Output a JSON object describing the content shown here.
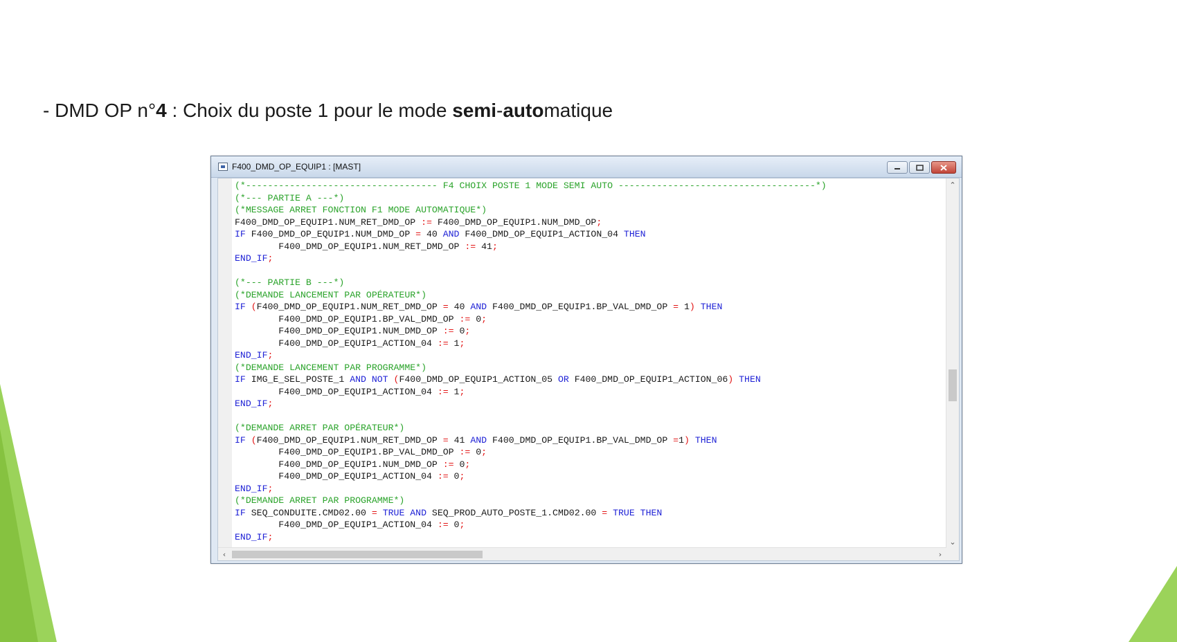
{
  "slide": {
    "title_prefix": "- DMD OP n°",
    "title_num": "4",
    "title_mid": " : Choix du poste 1 pour le mode ",
    "title_bold1": "semi",
    "title_dash": "-",
    "title_bold2": "auto",
    "title_end": "matique"
  },
  "window": {
    "title": "F400_DMD_OP_EQUIP1 : [MAST]",
    "buttons": [
      "minimize",
      "maximize",
      "close"
    ]
  },
  "colors": {
    "comment": "#2aa32a",
    "keyword": "#1f22d6",
    "operator": "#e21414",
    "accent_green": "#8cc63f"
  },
  "code_lines": [
    [
      [
        "c",
        "(*----------------------------------- F4 CHOIX POSTE 1 MODE SEMI AUTO ------------------------------------*)"
      ]
    ],
    [
      [
        "c",
        "(*--- PARTIE A ---*)"
      ]
    ],
    [
      [
        "c",
        "(*MESSAGE ARRET FONCTION F1 MODE AUTOMATIQUE*)"
      ]
    ],
    [
      [
        "t",
        "F400_DMD_OP_EQUIP1.NUM_RET_DMD_OP "
      ],
      [
        "o",
        ":="
      ],
      [
        "t",
        " F400_DMD_OP_EQUIP1.NUM_DMD_OP"
      ],
      [
        "o",
        ";"
      ]
    ],
    [
      [
        "k",
        "IF"
      ],
      [
        "t",
        " F400_DMD_OP_EQUIP1.NUM_DMD_OP "
      ],
      [
        "o",
        "="
      ],
      [
        "t",
        " 40 "
      ],
      [
        "k",
        "AND"
      ],
      [
        "t",
        " F400_DMD_OP_EQUIP1_ACTION_04 "
      ],
      [
        "k",
        "THEN"
      ]
    ],
    [
      [
        "t",
        "        F400_DMD_OP_EQUIP1.NUM_RET_DMD_OP "
      ],
      [
        "o",
        ":="
      ],
      [
        "t",
        " 41"
      ],
      [
        "o",
        ";"
      ]
    ],
    [
      [
        "k",
        "END_IF"
      ],
      [
        "o",
        ";"
      ]
    ],
    [],
    [
      [
        "c",
        "(*--- PARTIE B ---*)"
      ]
    ],
    [
      [
        "c",
        "(*DEMANDE LANCEMENT PAR OPÉRATEUR*)"
      ]
    ],
    [
      [
        "k",
        "IF"
      ],
      [
        "t",
        " "
      ],
      [
        "o",
        "("
      ],
      [
        "t",
        "F400_DMD_OP_EQUIP1.NUM_RET_DMD_OP "
      ],
      [
        "o",
        "="
      ],
      [
        "t",
        " 40 "
      ],
      [
        "k",
        "AND"
      ],
      [
        "t",
        " F400_DMD_OP_EQUIP1.BP_VAL_DMD_OP "
      ],
      [
        "o",
        "="
      ],
      [
        "t",
        " 1"
      ],
      [
        "o",
        ")"
      ],
      [
        "t",
        " "
      ],
      [
        "k",
        "THEN"
      ]
    ],
    [
      [
        "t",
        "        F400_DMD_OP_EQUIP1.BP_VAL_DMD_OP "
      ],
      [
        "o",
        ":="
      ],
      [
        "t",
        " 0"
      ],
      [
        "o",
        ";"
      ]
    ],
    [
      [
        "t",
        "        F400_DMD_OP_EQUIP1.NUM_DMD_OP "
      ],
      [
        "o",
        ":="
      ],
      [
        "t",
        " 0"
      ],
      [
        "o",
        ";"
      ]
    ],
    [
      [
        "t",
        "        F400_DMD_OP_EQUIP1_ACTION_04 "
      ],
      [
        "o",
        ":="
      ],
      [
        "t",
        " 1"
      ],
      [
        "o",
        ";"
      ]
    ],
    [
      [
        "k",
        "END_IF"
      ],
      [
        "o",
        ";"
      ]
    ],
    [
      [
        "c",
        "(*DEMANDE LANCEMENT PAR PROGRAMME*)"
      ]
    ],
    [
      [
        "k",
        "IF"
      ],
      [
        "t",
        " IMG_E_SEL_POSTE_1 "
      ],
      [
        "k",
        "AND NOT"
      ],
      [
        "t",
        " "
      ],
      [
        "o",
        "("
      ],
      [
        "t",
        "F400_DMD_OP_EQUIP1_ACTION_05 "
      ],
      [
        "k",
        "OR"
      ],
      [
        "t",
        " F400_DMD_OP_EQUIP1_ACTION_06"
      ],
      [
        "o",
        ")"
      ],
      [
        "t",
        " "
      ],
      [
        "k",
        "THEN"
      ]
    ],
    [
      [
        "t",
        "        F400_DMD_OP_EQUIP1_ACTION_04 "
      ],
      [
        "o",
        ":="
      ],
      [
        "t",
        " 1"
      ],
      [
        "o",
        ";"
      ]
    ],
    [
      [
        "k",
        "END_IF"
      ],
      [
        "o",
        ";"
      ]
    ],
    [],
    [
      [
        "c",
        "(*DEMANDE ARRET PAR OPÉRATEUR*)"
      ]
    ],
    [
      [
        "k",
        "IF"
      ],
      [
        "t",
        " "
      ],
      [
        "o",
        "("
      ],
      [
        "t",
        "F400_DMD_OP_EQUIP1.NUM_RET_DMD_OP "
      ],
      [
        "o",
        "="
      ],
      [
        "t",
        " 41 "
      ],
      [
        "k",
        "AND"
      ],
      [
        "t",
        " F400_DMD_OP_EQUIP1.BP_VAL_DMD_OP "
      ],
      [
        "o",
        "="
      ],
      [
        "t",
        "1"
      ],
      [
        "o",
        ")"
      ],
      [
        "t",
        " "
      ],
      [
        "k",
        "THEN"
      ]
    ],
    [
      [
        "t",
        "        F400_DMD_OP_EQUIP1.BP_VAL_DMD_OP "
      ],
      [
        "o",
        ":="
      ],
      [
        "t",
        " 0"
      ],
      [
        "o",
        ";"
      ]
    ],
    [
      [
        "t",
        "        F400_DMD_OP_EQUIP1.NUM_DMD_OP "
      ],
      [
        "o",
        ":="
      ],
      [
        "t",
        " 0"
      ],
      [
        "o",
        ";"
      ]
    ],
    [
      [
        "t",
        "        F400_DMD_OP_EQUIP1_ACTION_04 "
      ],
      [
        "o",
        ":="
      ],
      [
        "t",
        " 0"
      ],
      [
        "o",
        ";"
      ]
    ],
    [
      [
        "k",
        "END_IF"
      ],
      [
        "o",
        ";"
      ]
    ],
    [
      [
        "c",
        "(*DEMANDE ARRET PAR PROGRAMME*)"
      ]
    ],
    [
      [
        "k",
        "IF"
      ],
      [
        "t",
        " SEQ_CONDUITE.CMD02.00 "
      ],
      [
        "o",
        "="
      ],
      [
        "t",
        " "
      ],
      [
        "k",
        "TRUE AND"
      ],
      [
        "t",
        " SEQ_PROD_AUTO_POSTE_1.CMD02.00 "
      ],
      [
        "o",
        "="
      ],
      [
        "t",
        " "
      ],
      [
        "k",
        "TRUE THEN"
      ]
    ],
    [
      [
        "t",
        "        F400_DMD_OP_EQUIP1_ACTION_04 "
      ],
      [
        "o",
        ":="
      ],
      [
        "t",
        " 0"
      ],
      [
        "o",
        ";"
      ]
    ],
    [
      [
        "k",
        "END_IF"
      ],
      [
        "o",
        ";"
      ]
    ]
  ]
}
